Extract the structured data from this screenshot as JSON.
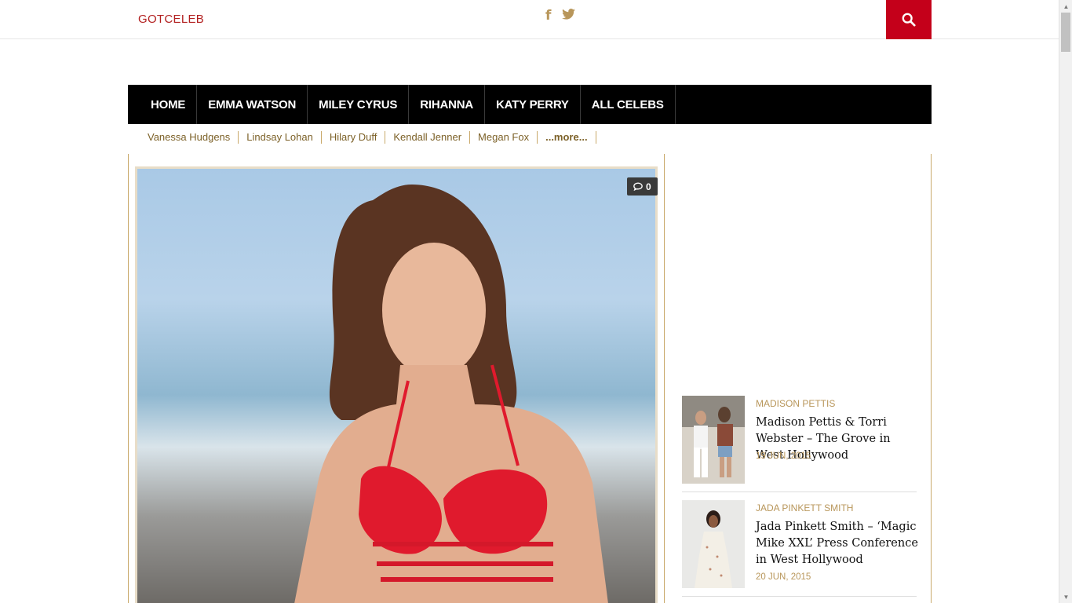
{
  "site": {
    "logo": "GOTCELEB"
  },
  "social": {
    "facebook_icon": "f",
    "twitter_icon": "twitter-bird"
  },
  "search": {
    "icon": "magnifier"
  },
  "nav": {
    "items": [
      {
        "label": "HOME"
      },
      {
        "label": "EMMA WATSON"
      },
      {
        "label": "MILEY CYRUS"
      },
      {
        "label": "RIHANNA"
      },
      {
        "label": "KATY PERRY"
      },
      {
        "label": "ALL CELEBS"
      }
    ]
  },
  "subnav": {
    "items": [
      {
        "label": "Vanessa Hudgens"
      },
      {
        "label": "Lindsay Lohan"
      },
      {
        "label": "Hilary Duff"
      },
      {
        "label": "Kendall Jenner"
      },
      {
        "label": "Megan Fox"
      },
      {
        "label": "...more..."
      }
    ]
  },
  "feature": {
    "comments": "0"
  },
  "sidebar": {
    "posts": [
      {
        "category": "MADISON PETTIS",
        "title": "Madison Pettis & Torri Webster – The Grove in West Hollywood",
        "date": "19 JUN, 2015"
      },
      {
        "category": "JADA PINKETT SMITH",
        "title": "Jada Pinkett Smith – ‘Magic Mike XXL’ Press Conference in West Hollywood",
        "date": "20 JUN, 2015"
      }
    ]
  },
  "colors": {
    "accent_red": "#c4001a",
    "gold": "#b8965a",
    "nav_bg": "#000000"
  }
}
